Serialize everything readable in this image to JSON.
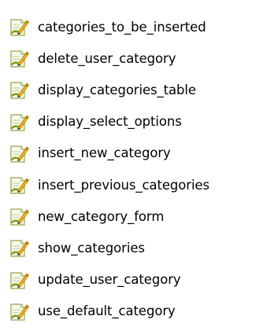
{
  "file_icon": {
    "name": "script-file-edit-icon",
    "colors": {
      "page_fill": "#f7f9eb",
      "page_border": "#8ea84b",
      "page_lines": "#c8d59a",
      "accent_green": "#6fa10a",
      "pencil_body": "#f2b21a",
      "pencil_tip": "#3a2a10"
    }
  },
  "files": [
    {
      "label": "categories_to_be_inserted"
    },
    {
      "label": "delete_user_category"
    },
    {
      "label": "display_categories_table"
    },
    {
      "label": "display_select_options"
    },
    {
      "label": "insert_new_category"
    },
    {
      "label": "insert_previous_categories"
    },
    {
      "label": "new_category_form"
    },
    {
      "label": "show_categories"
    },
    {
      "label": "update_user_category"
    },
    {
      "label": "use_default_category"
    }
  ]
}
